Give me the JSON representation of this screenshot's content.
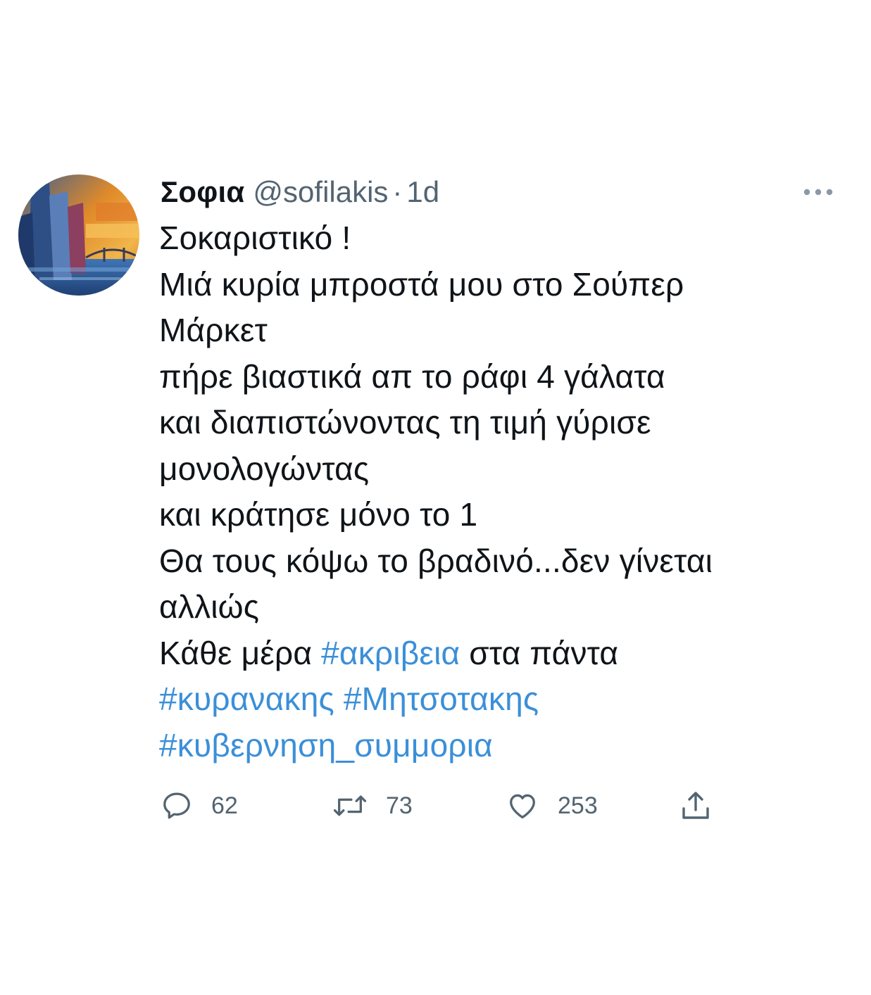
{
  "tweet": {
    "author": {
      "display_name": "Σοφια",
      "handle": "@sofilakis",
      "separator": "·",
      "time": "1d"
    },
    "body_lines": [
      {
        "parts": [
          {
            "text": "Σοκαριστικό !",
            "hashtag": false
          }
        ]
      },
      {
        "parts": [
          {
            "text": "Μιά κυρία μπροστά μου στο Σούπερ",
            "hashtag": false
          }
        ]
      },
      {
        "parts": [
          {
            "text": "Μάρκετ",
            "hashtag": false
          }
        ]
      },
      {
        "parts": [
          {
            "text": "πήρε βιαστικά απ το ράφι 4 γάλατα",
            "hashtag": false
          }
        ]
      },
      {
        "parts": [
          {
            "text": "και διαπιστώνοντας τη τιμή γύρισε",
            "hashtag": false
          }
        ]
      },
      {
        "parts": [
          {
            "text": "μονολογώντας",
            "hashtag": false
          }
        ]
      },
      {
        "parts": [
          {
            "text": "και κράτησε μόνο το 1",
            "hashtag": false
          }
        ]
      },
      {
        "parts": [
          {
            "text": "Θα τους κόψω το βραδινό...δεν γίνεται",
            "hashtag": false
          }
        ]
      },
      {
        "parts": [
          {
            "text": "αλλιώς",
            "hashtag": false
          }
        ]
      },
      {
        "parts": [
          {
            "text": "Κάθε μέρα ",
            "hashtag": false
          },
          {
            "text": "#ακριβεια",
            "hashtag": true
          },
          {
            "text": " στα πάντα",
            "hashtag": false
          }
        ]
      },
      {
        "parts": [
          {
            "text": "#κυρανακης",
            "hashtag": true
          },
          {
            "text": " ",
            "hashtag": false
          },
          {
            "text": "#Μητσοτακης",
            "hashtag": true
          }
        ]
      },
      {
        "parts": [
          {
            "text": "#κυβερνηση_συμμορια",
            "hashtag": true
          }
        ]
      }
    ],
    "actions": {
      "reply_count": "62",
      "retweet_count": "73",
      "like_count": "253"
    },
    "icons": {
      "avatar": "avatar-painting",
      "more": "more-horizontal-icon",
      "reply": "reply-icon",
      "retweet": "retweet-icon",
      "like": "heart-icon",
      "share": "share-icon"
    },
    "colors": {
      "text": "#0f1419",
      "secondary": "#536471",
      "hashtag": "#3b8fd8",
      "icon": "#536471"
    }
  }
}
